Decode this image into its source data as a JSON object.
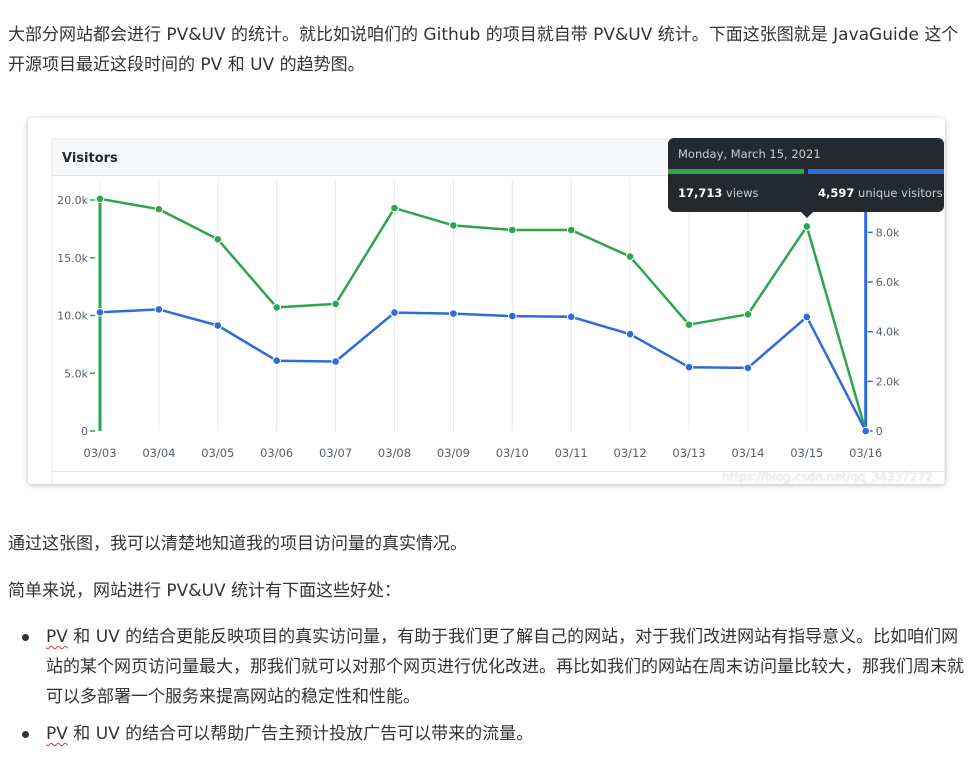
{
  "intro": "大部分网站都会进行 PV&UV 的统计。就比如说咱们的 Github 的项目就自带 PV&UV 统计。下面这张图就是 JavaGuide 这个开源项目最近这段时间的 PV 和 UV 的趋势图。",
  "p2": "通过这张图，我可以清楚地知道我的项目访问量的真实情况。",
  "p3": "简单来说，网站进行 PV&UV 统计有下面这些好处：",
  "bullets": [
    {
      "abbr": "PV",
      "text": " 和 UV 的结合更能反映项目的真实访问量，有助于我们更了解自己的网站，对于我们改进网站有指导意义。比如咱们网站的某个网页访问量最大，那我们就可以对那个网页进行优化改进。再比如我们的网站在周末访问量比较大，那我们周末就可以多部署一个服务来提高网站的稳定性和性能。"
    },
    {
      "abbr": "PV",
      "text": " 和 UV 的结合可以帮助广告主预计投放广告可以带来的流量。"
    }
  ],
  "watermark": "https://blog.csdn.net/qq_34337272",
  "tooltip": {
    "date": "Monday, March 15, 2021",
    "views": "17,713",
    "views_label": "views",
    "uv": "4,597",
    "uv_label": "unique visitors"
  },
  "colors": {
    "views": "#2ea44f",
    "unique": "#2f6bd9"
  },
  "chart_data": {
    "type": "line",
    "title": "Visitors",
    "categories": [
      "03/03",
      "03/04",
      "03/05",
      "03/06",
      "03/07",
      "03/08",
      "03/09",
      "03/10",
      "03/11",
      "03/12",
      "03/13",
      "03/14",
      "03/15",
      "03/16"
    ],
    "series": [
      {
        "name": "views",
        "axis": "left",
        "values": [
          20100,
          19200,
          16600,
          10700,
          11000,
          19300,
          17800,
          17400,
          17400,
          15100,
          9200,
          10100,
          17713,
          0
        ]
      },
      {
        "name": "unique visitors",
        "axis": "right",
        "values": [
          4780,
          4900,
          4250,
          2830,
          2800,
          4770,
          4730,
          4630,
          4600,
          3900,
          2570,
          2540,
          4597,
          0
        ]
      }
    ],
    "left_axis": {
      "ticks": [
        "0",
        "5.0k",
        "10.0k",
        "15.0k",
        "20.0k"
      ],
      "range": [
        0,
        20000
      ]
    },
    "right_axis": {
      "ticks": [
        "0",
        "2.0k",
        "4.0k",
        "6.0k",
        "8.0k"
      ],
      "range": [
        0,
        9300
      ]
    },
    "grid": true
  }
}
